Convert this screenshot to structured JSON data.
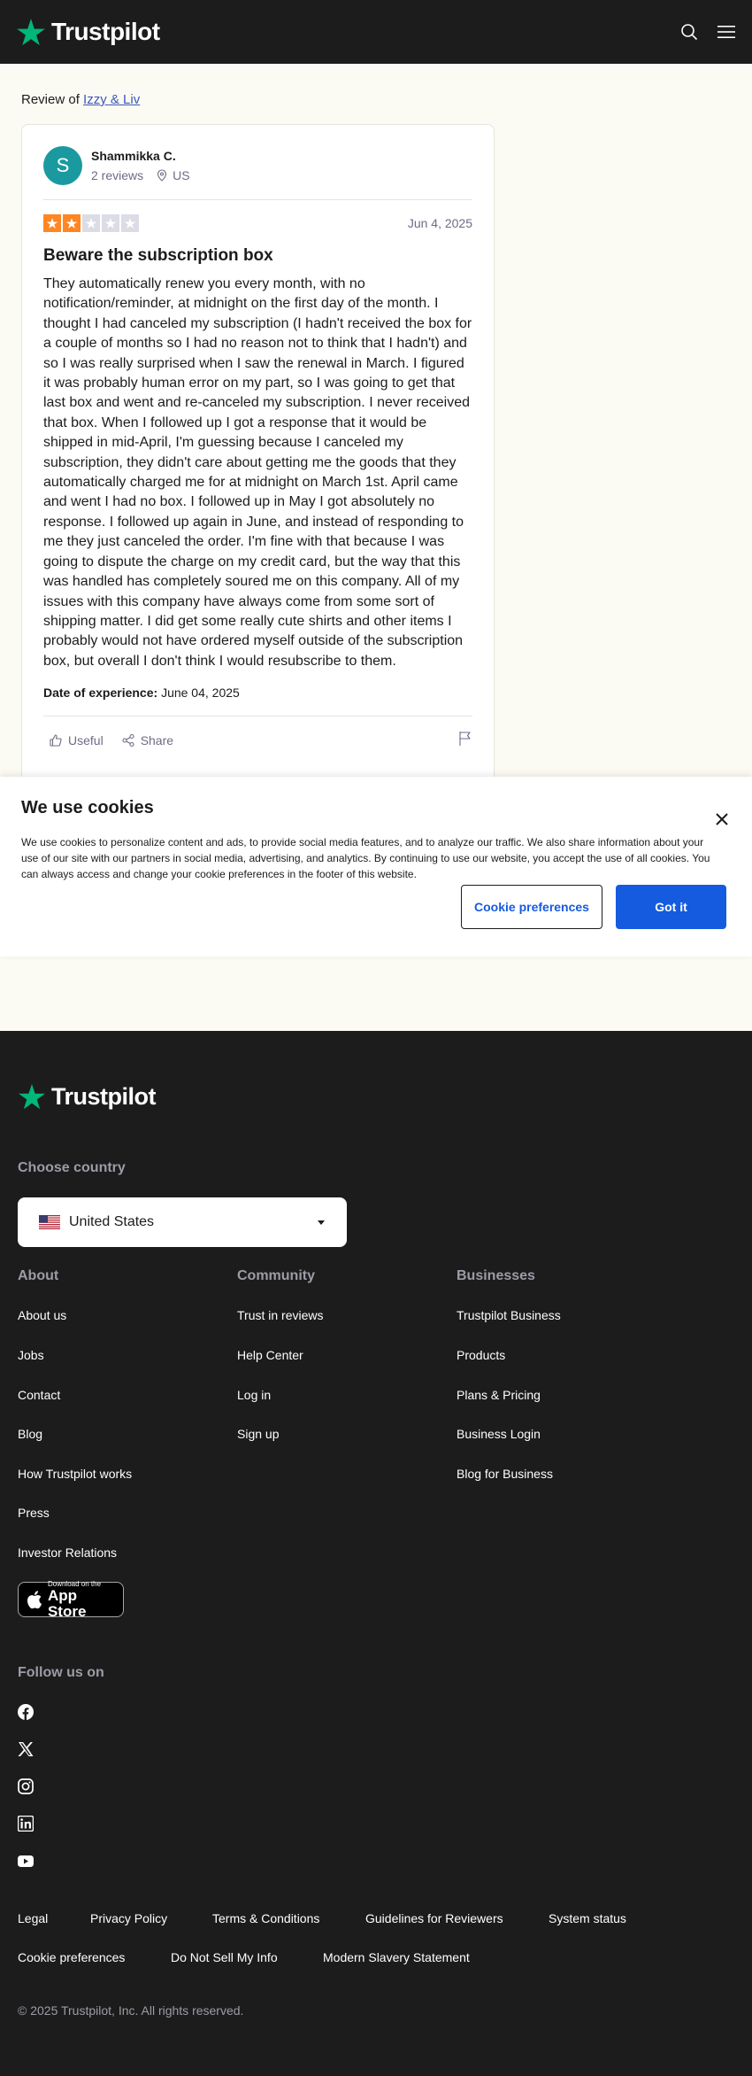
{
  "header": {
    "logo_text": "Trustpilot",
    "brand_color": "#00b67a",
    "icons": [
      "search-icon",
      "menu-icon"
    ]
  },
  "breadcrumb": {
    "prefix": "Review of",
    "company": "Izzy & Liv"
  },
  "review": {
    "avatar_letter": "S",
    "reviewer_name": "Shammikka C.",
    "reviews_count": "2 reviews",
    "location": "US",
    "rating": 2,
    "max_rating": 5,
    "date": "Jun 4, 2025",
    "title": "Beware the subscription box",
    "body": "They automatically renew you every month, with no notification/reminder, at midnight on the first day of the month. I thought I had canceled my subscription (I hadn't received the box for a couple of months so I had no reason not to think that I hadn't) and so I was really surprised when I saw the renewal in March. I figured it was probably human error on my part, so I was going to get that last box and went and re-canceled my subscription. I never received that box. When I followed up I got a response that it would be shipped in mid-April, I'm guessing because I canceled my subscription, they didn't care about getting me the goods that they automatically charged me for at midnight on March 1st. April came and went I had no box. I followed up in May I got absolutely no response. I followed up again in June, and instead of responding to me they just canceled the order. I'm fine with that because I was going to dispute the charge on my credit card, but the way that this was handled has completely soured me on this company. All of my issues with this company have always come from some sort of shipping matter. I did get some really cute shirts and other items I probably would not have ordered myself outside of the subscription box, but overall I don't think I would resubscribe to them.",
    "doe_label": "Date of experience:",
    "doe_value": "June 04, 2025",
    "useful_label": "Useful",
    "share_label": "Share",
    "star_filled_color": "#ff8622",
    "star_empty_color": "#dcdce6"
  },
  "cookie": {
    "title": "We use cookies",
    "text": "We use cookies to personalize content and ads, to provide social media features, and to analyze our traffic. We also share information about your use of our site with our partners in social media, advertising, and analytics. By continuing to use our website, you accept the use of all cookies. You can always access and change your cookie preferences in the footer of this website.",
    "preferences_label": "Cookie preferences",
    "accept_label": "Got it"
  },
  "footer": {
    "logo_text": "Trustpilot",
    "choose_country": "Choose country",
    "country": "United States",
    "about_heading": "About",
    "about_links": [
      "About us",
      "Jobs",
      "Contact",
      "Blog",
      "How Trustpilot works",
      "Press",
      "Investor Relations"
    ],
    "community_heading": "Community",
    "community_links": [
      "Trust in reviews",
      "Help Center",
      "Log in",
      "Sign up"
    ],
    "businesses_heading": "Businesses",
    "businesses_links": [
      "Trustpilot Business",
      "Products",
      "Plans & Pricing",
      "Business Login",
      "Blog for Business"
    ],
    "app_store_small": "Download on the",
    "app_store_big": "App Store",
    "follow_heading": "Follow us on",
    "social_icons": [
      "facebook-icon",
      "x-icon",
      "instagram-icon",
      "linkedin-icon",
      "youtube-icon"
    ],
    "legal_links_row1": [
      "Legal",
      "Privacy Policy",
      "Terms & Conditions",
      "Guidelines for Reviewers",
      "System status"
    ],
    "legal_links_row2": [
      "Cookie preferences",
      "Do Not Sell My Info",
      "Modern Slavery Statement"
    ],
    "copyright": "© 2025 Trustpilot, Inc. All rights reserved."
  }
}
